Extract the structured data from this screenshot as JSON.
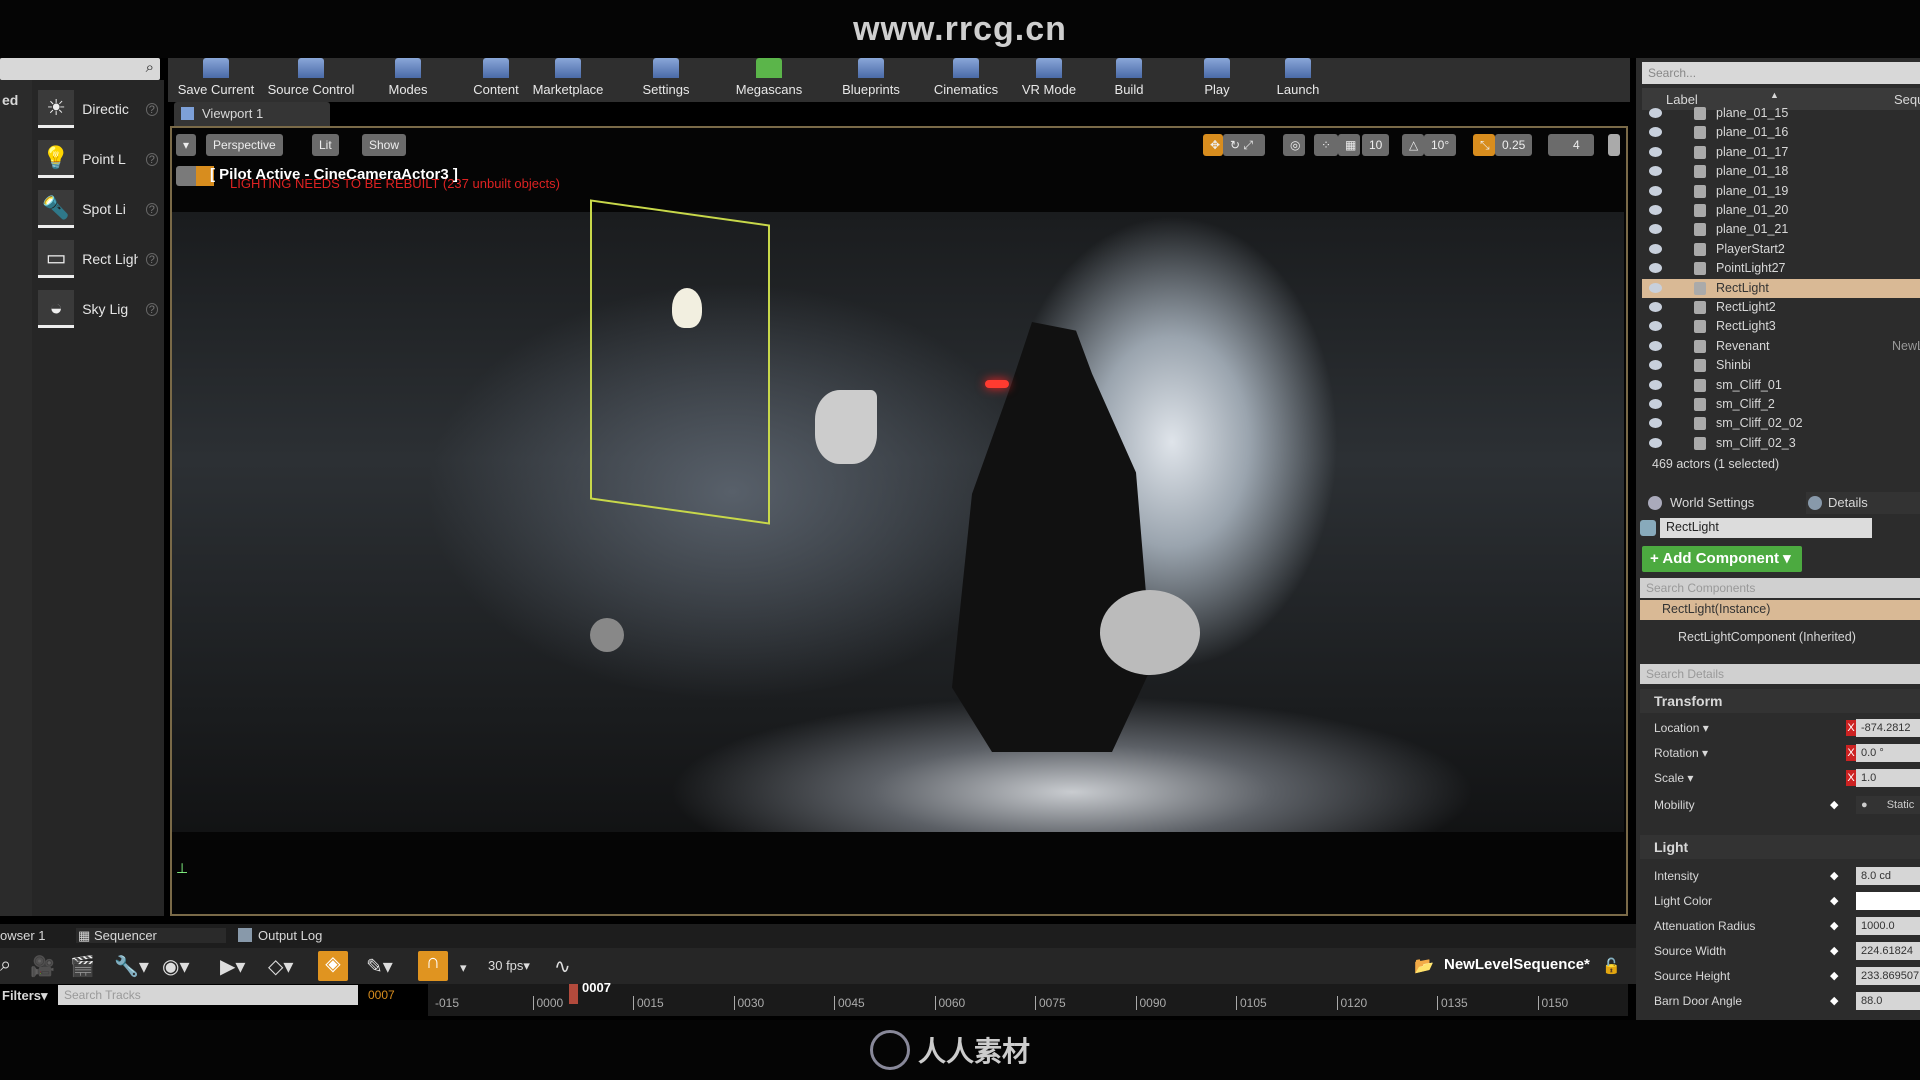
{
  "watermark_url": "www.rrcg.cn",
  "left_panel": {
    "partial_label": "ed",
    "items": [
      {
        "label": "Directic",
        "icon": "directional-light-icon"
      },
      {
        "label": "Point L",
        "icon": "point-light-icon"
      },
      {
        "label": "Spot Li",
        "icon": "spot-light-icon"
      },
      {
        "label": "Rect Light",
        "icon": "rect-light-icon"
      },
      {
        "label": "Sky Lig",
        "icon": "sky-light-icon"
      }
    ]
  },
  "toolbar": [
    "Save Current",
    "Source Control",
    "Modes",
    "Content",
    "Marketplace",
    "Settings",
    "Megascans",
    "Blueprints",
    "Cinematics",
    "VR Mode",
    "Build",
    "Play",
    "Launch"
  ],
  "viewport": {
    "tab": "Viewport 1",
    "perspective": "Perspective",
    "lit": "Lit",
    "show": "Show",
    "pilot": "[ Pilot Active - CineCameraActor3 ]",
    "warning": "LIGHTING NEEDS TO BE REBUILT (237 unbuilt objects)",
    "grid": "10",
    "angle": "10°",
    "scale": "0.25",
    "cam_speed": "4"
  },
  "outliner": {
    "search_placeholder": "Search...",
    "col_label": "Label",
    "col_seq": "Sequ",
    "rows": [
      {
        "name": "plane_01_15"
      },
      {
        "name": "plane_01_16"
      },
      {
        "name": "plane_01_17"
      },
      {
        "name": "plane_01_18"
      },
      {
        "name": "plane_01_19"
      },
      {
        "name": "plane_01_20"
      },
      {
        "name": "plane_01_21"
      },
      {
        "name": "PlayerStart2"
      },
      {
        "name": "PointLight27"
      },
      {
        "name": "RectLight",
        "selected": true
      },
      {
        "name": "RectLight2"
      },
      {
        "name": "RectLight3"
      },
      {
        "name": "Revenant",
        "seq": "NewL"
      },
      {
        "name": "Shinbi"
      },
      {
        "name": "sm_Cliff_01"
      },
      {
        "name": "sm_Cliff_2"
      },
      {
        "name": "sm_Cliff_02_02"
      },
      {
        "name": "sm_Cliff_02_3"
      }
    ],
    "count": "469 actors (1 selected)"
  },
  "details": {
    "tab_world": "World Settings",
    "tab_details": "Details",
    "name": "RectLight",
    "add_component": "+ Add Component ▾",
    "search_components": "Search Components",
    "instance": "RectLight(Instance)",
    "component": "RectLightComponent (Inherited)",
    "search_details": "Search Details",
    "transform": {
      "title": "Transform",
      "location_label": "Location ▾",
      "location": "-874.2812",
      "rotation_label": "Rotation ▾",
      "rotation": "0.0 °",
      "scale_label": "Scale ▾",
      "scale": "1.0",
      "mobility_label": "Mobility",
      "mobility": "Static"
    },
    "light": {
      "title": "Light",
      "props": [
        {
          "label": "Intensity",
          "value": "8.0 cd"
        },
        {
          "label": "Light Color",
          "value": ""
        },
        {
          "label": "Attenuation Radius",
          "value": "1000.0"
        },
        {
          "label": "Source Width",
          "value": "224.61824"
        },
        {
          "label": "Source Height",
          "value": "233.869507"
        },
        {
          "label": "Barn Door Angle",
          "value": "88.0"
        }
      ]
    }
  },
  "sequencer": {
    "tab_browser": "owser 1",
    "tab_sequencer": "Sequencer",
    "tab_output": "Output Log",
    "fps": "30 fps▾",
    "filters": "Filters▾",
    "search_placeholder": "Search Tracks",
    "frame": "0007",
    "playhead": "0007",
    "sequence": "NewLevelSequence*",
    "ticks": [
      "-015",
      "0000",
      "0015",
      "0030",
      "0045",
      "0060",
      "0075",
      "0090",
      "0105",
      "0120",
      "0135",
      "0150"
    ]
  },
  "bottom_logo": "人人素材",
  "colors": {
    "accent_orange": "#d88d1e",
    "add_green": "#4caa40",
    "selection": "#d9b995"
  }
}
